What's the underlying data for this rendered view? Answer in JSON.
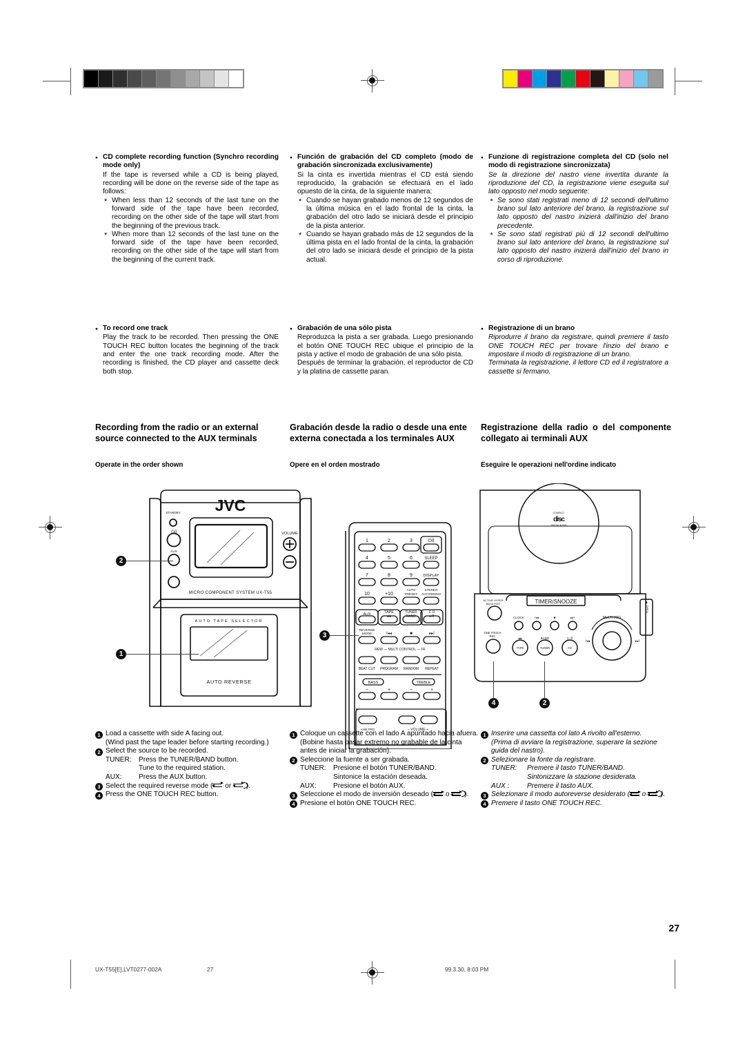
{
  "page_number": "27",
  "footer": {
    "model": "UX-T55[E],LVT0277-002A",
    "page": "27",
    "timestamp": "99.3.30, 8:03 PM"
  },
  "swatches": {
    "grayscale": [
      "#000000",
      "#1a1a1a",
      "#2f2f2f",
      "#4a4a4a",
      "#5e5e5e",
      "#757575",
      "#8f8f8f",
      "#a8a8a8",
      "#c4c4c4",
      "#e4e4e4",
      "#ffffff"
    ],
    "color": [
      "#fdeb00",
      "#e6007e",
      "#00a0e9",
      "#2e3192",
      "#00a04a",
      "#e60012",
      "#231815",
      "#fcf3a8",
      "#f5a3bf",
      "#70c8f0",
      "#9b9b9b"
    ]
  },
  "columns": {
    "english": {
      "blocks": [
        {
          "heading": "CD complete recording function (Synchro recording mode only)",
          "intro": "If the tape is reversed while a CD is being played, recording will be done on the reverse side of the tape as follows:",
          "stars": [
            "When less than 12 seconds of the last tune on the forward side of the tape have been recorded, recording on the other side of the tape will start from the beginning of the previous track.",
            "When more than 12 seconds of the last tune on the forward side of the tape have been recorded, recording on the other side of the tape will start from the beginning of the current track."
          ]
        },
        {
          "heading": "To record one track",
          "intro": "Play the track to be recorded. Then pressing the ONE TOUCH REC button locates the beginning of the track and enter the one track recording mode. After the recording is finished, the CD player and cassette deck both stop.",
          "stars": []
        }
      ],
      "section_title": "Recording from the radio or an external source connected to the AUX  terminals",
      "section_sub": "Operate in the order shown",
      "steps": [
        {
          "n": "1",
          "lines": [
            "Load a cassette with side A facing out.",
            "(Wind past the tape leader before starting recording.)"
          ],
          "pairs": []
        },
        {
          "n": "2",
          "lines": [
            "Select the source to be recorded."
          ],
          "pairs": [
            {
              "k": "TUNER:",
              "v": "Press the TUNER/BAND button."
            },
            {
              "k": "",
              "v": "Tune to the required station."
            },
            {
              "k": "AUX:",
              "v": "Press the AUX button."
            }
          ]
        },
        {
          "n": "3",
          "lines": [
            "Select the required reverse mode (",
            " or ",
            ")."
          ],
          "pairs": [],
          "reverse_icons": true
        },
        {
          "n": "4",
          "lines": [
            "Press the ONE TOUCH REC button."
          ],
          "pairs": []
        }
      ]
    },
    "spanish": {
      "blocks": [
        {
          "heading": "Función de grabación del CD completo (modo de grabación sincronizada exclusivamente)",
          "intro": "Si la cinta es invertida mientras el CD está siendo reproducido, la grabación se efectuará en el lado opuesto de la cinta, de la siguiente manera:",
          "stars": [
            "Cuando se hayan grabado menos de 12 segundos de la última música en el lado frontal de la cinta, la grabación del otro lado se iniciará desde el principio de la pista anterior.",
            "Cuando se hayan grabado más de 12 segundos de la última pista en el lado frontal de la cinta, la grabación del otro lado se iniciará desde el principio de la pista actual."
          ]
        },
        {
          "heading": "Grabación de una sólo pista",
          "intro": "Reproduzca la pista a ser grabada. Luego presionando el botón ONE TOUCH REC ubique el principio de la pista y active el modo de grabación de una sólo pista.",
          "intro2": "Después de terminar la grabación, el reproductor de CD y la platina de cassette paran.",
          "stars": []
        }
      ],
      "section_title": "Grabación desde la radio o desde una ente externa conectada a los terminales AUX",
      "section_sub": "Opere en el orden mostrado",
      "steps": [
        {
          "n": "1",
          "lines": [
            "Coloque un cassette con el lado A apuntado hacia afuera.",
            "(Bobine hasta pasar extremo no grabable de la cinta antes de iniciar la grabación)."
          ],
          "pairs": []
        },
        {
          "n": "2",
          "lines": [
            "Seleccione la fuente a ser grabada."
          ],
          "pairs": [
            {
              "k": "TUNER:",
              "v": "Presione el botón TUNER/BAND."
            },
            {
              "k": "",
              "v": "Sintonice la estación deseada."
            },
            {
              "k": "AUX:",
              "v": "Presione el botón AUX."
            }
          ]
        },
        {
          "n": "3",
          "lines": [
            "Seleccione el modo de inversión deseado (",
            " o ",
            ")."
          ],
          "pairs": [],
          "reverse_icons": true
        },
        {
          "n": "4",
          "lines": [
            "Presione el botón ONE TOUCH REC."
          ],
          "pairs": []
        }
      ]
    },
    "italian": {
      "blocks": [
        {
          "heading": "Funzione di registrazione completa del CD (solo nel modo di registrazione sincronizzata)",
          "intro": "Se la direzione del nastro viene invertita durante la riproduzione del CD, la registrazione viene eseguita sul lato opposto nel modo seguente:",
          "stars": [
            "Se sono stati registrati meno di 12 secondi dell'ultimo brano sul lato anteriore del brano, la registrazione sul lato opposto del nastro inizierà dall'inizio del brano precedente.",
            "Se sono stati registrati più di 12 secondi dell'ultimo brano sul lato anteriore del brano, la registrazione sul lato opposto del nastro inizierà dall'inizio del brano in corso di riproduzione."
          ]
        },
        {
          "heading": "Registrazione di un brano",
          "intro": "Riprodurre il brano da registrare, quindi premere il tasto ONE TOUCH REC per trovare l'inzio del brano e impostare il modo di registrazione di un brano.",
          "intro2": "Terminata la registrazione, il lettore CD ed il registratore a cassette si fermano.",
          "stars": []
        }
      ],
      "section_title": "Registrazione della radio o del componente collegato ai terminali AUX",
      "section_sub": "Eseguire le operazioni nell'ordine indicato",
      "steps": [
        {
          "n": "1",
          "lines": [
            "Inserire una cassetta col lato A rivolto all'esterno.",
            "(Prima di avviare la registrazione, superare la sezione guida del nastro)."
          ],
          "pairs": []
        },
        {
          "n": "2",
          "lines": [
            "Selezionare la fonte da registrare."
          ],
          "pairs": [
            {
              "k": "TUNER:",
              "v": "Premere il tasto TUNER/BAND."
            },
            {
              "k": "",
              "v": "Sintonizzare   la   stazione desiderata."
            },
            {
              "k": "AUX  :",
              "v": "Premere il tasto AUX."
            }
          ]
        },
        {
          "n": "3",
          "lines": [
            "Selezionare il modo autoreverse desiderato (",
            " o ",
            ")."
          ],
          "pairs": [],
          "reverse_icons": true
        },
        {
          "n": "4",
          "lines": [
            "Premere il tasto ONE TOUCH REC."
          ],
          "pairs": []
        }
      ]
    }
  },
  "illustrations": {
    "main_unit": {
      "brand": "JVC",
      "standby_label": "STANDBY",
      "power_label": "⏻/I",
      "aux_label": "AUX",
      "volume_label": "VOLUME",
      "volume_plus": "+",
      "volume_minus": "−",
      "model_line": "MICRO  COMPONENT  SYSTEM UX-T55",
      "tape_selector_label": "A U T O   T A P E   S E L E C T O R",
      "auto_reverse_label": "AUTO  REVERSE",
      "callouts": [
        "2",
        "1"
      ]
    },
    "remote": {
      "numeric_keys": [
        "1",
        "2",
        "3",
        "4",
        "5",
        "6",
        "7",
        "8",
        "9",
        "10",
        "+10"
      ],
      "power_key": "⏻/I",
      "sleep_key": "SLEEP",
      "display_key": "DISPLAY",
      "auto_preset_key": "AUTO PRESET",
      "stereo_key": "STEREO AUTO/MONO",
      "source_keys": [
        "AUX",
        "TAPE",
        "TUNER BAND",
        "C D"
      ],
      "reverse_mode_key": "REVERSE MODE",
      "transport_labels": [
        "◂◂",
        "■",
        "▸▸"
      ],
      "multi_control_label": "REW — MULTI  CONTROL — FF",
      "function_keys": [
        "BEAT CUT",
        "PROGRAM",
        "RANDOM",
        "REPEAT"
      ],
      "bass_label": "BASS",
      "treble_label": "TREBLE",
      "minus": "−",
      "plus": "+",
      "ahb_label": "AHB PRO",
      "volume_label": "− VOLUME +",
      "callouts": [
        "3"
      ]
    },
    "panel": {
      "disc_label": "COMPACT disc DIGITAL AUDIO",
      "timer_label": "TIMER/SNOOZE",
      "active_bass_label": "ACTIVE HYPER BASS PRO",
      "one_touch_label": "ONE TOUCH REC",
      "clock_label": "CLOCK",
      "tape_label": "TAPE",
      "band_label": "BAND",
      "tuner_label": "TUNER",
      "cd_label": "CD",
      "play_pause_label": "▷ II",
      "multi_jog_label": "MULTI JOG",
      "open_label": "OPEN",
      "callouts": [
        "4",
        "2"
      ]
    }
  }
}
